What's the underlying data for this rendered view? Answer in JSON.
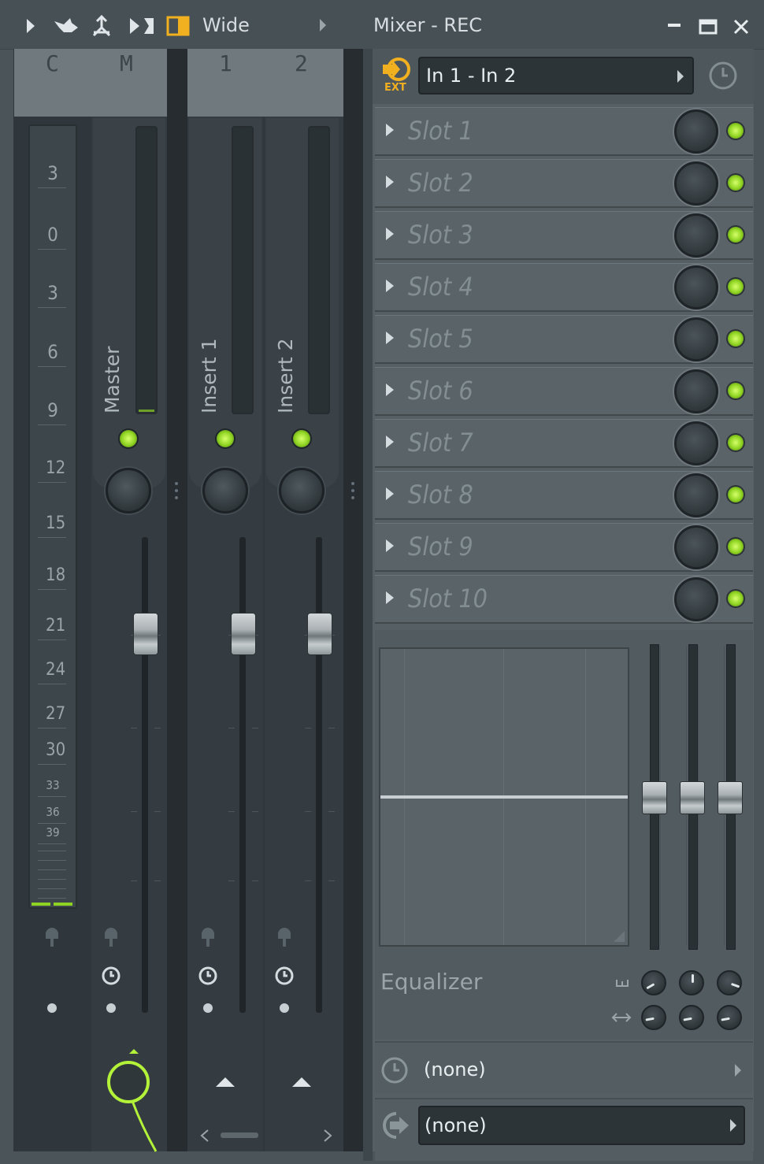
{
  "window": {
    "title": "Mixer - REC",
    "view_mode": "Wide",
    "controls": [
      "minimize-icon",
      "maximize-icon",
      "close-icon"
    ]
  },
  "toolbar": {
    "icons": [
      "play-arrow-icon",
      "bird-icon",
      "pin-icon",
      "send-icon",
      "layout-icon"
    ]
  },
  "strips": {
    "header_labels": [
      "C",
      "M",
      "1",
      "2"
    ],
    "names": [
      "Master",
      "Insert 1",
      "Insert 2"
    ]
  },
  "meter": {
    "db_labels": [
      "3",
      "0",
      "3",
      "6",
      "9",
      "12",
      "15",
      "18",
      "21",
      "24",
      "27",
      "30",
      "33",
      "36",
      "39"
    ]
  },
  "fx": {
    "input": {
      "icon": "ext-input-icon",
      "badge": "EXT",
      "value": "In 1 - In 2"
    },
    "slots": [
      "Slot 1",
      "Slot 2",
      "Slot 3",
      "Slot 4",
      "Slot 5",
      "Slot 6",
      "Slot 7",
      "Slot 8",
      "Slot 9",
      "Slot 10"
    ],
    "eq": {
      "title": "Equalizer"
    },
    "latency": {
      "value": "(none)"
    },
    "output": {
      "value": "(none)"
    }
  },
  "colors": {
    "led_green": "#8ed321",
    "route_green": "#b4f23a",
    "panel": "#565f64",
    "strip": "#343c41"
  }
}
